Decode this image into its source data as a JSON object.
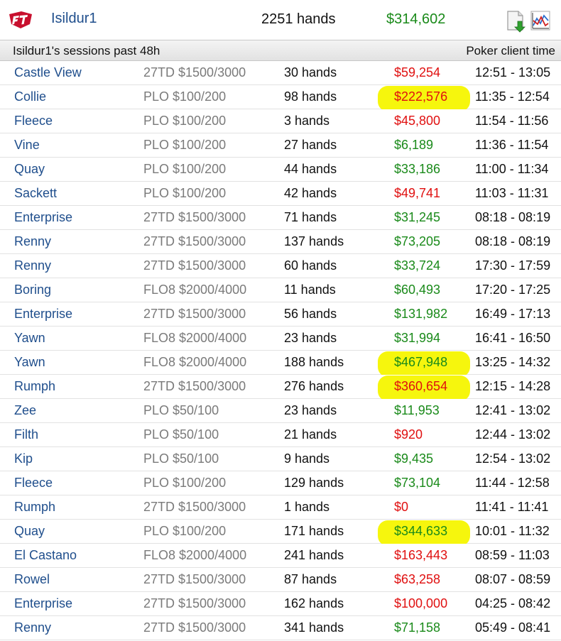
{
  "header": {
    "player_name": "Isildur1",
    "total_hands": "2251 hands",
    "total_profit": "$314,602",
    "icons": [
      "full-tilt-logo-icon",
      "export-icon",
      "graph-icon"
    ],
    "accent_color": "#1f4e8c"
  },
  "subheader": {
    "title": "Isildur1's sessions past 48h",
    "right_label": "Poker client time"
  },
  "colors": {
    "positive": "#1a8a1a",
    "negative": "#e01010",
    "highlight": "#f5f500"
  },
  "sessions": [
    {
      "table": "Castle View",
      "game": "27TD $1500/3000",
      "hands": "30 hands",
      "profit": "$59,254",
      "sign": "neg",
      "time": "12:51 - 13:05",
      "highlight": false
    },
    {
      "table": "Collie",
      "game": "PLO $100/200",
      "hands": "98 hands",
      "profit": "$222,576",
      "sign": "neg",
      "time": "11:35 - 12:54",
      "highlight": true
    },
    {
      "table": "Fleece",
      "game": "PLO $100/200",
      "hands": "3 hands",
      "profit": "$45,800",
      "sign": "neg",
      "time": "11:54 - 11:56",
      "highlight": false
    },
    {
      "table": "Vine",
      "game": "PLO $100/200",
      "hands": "27 hands",
      "profit": "$6,189",
      "sign": "pos",
      "time": "11:36 - 11:54",
      "highlight": false
    },
    {
      "table": "Quay",
      "game": "PLO $100/200",
      "hands": "44 hands",
      "profit": "$33,186",
      "sign": "pos",
      "time": "11:00 - 11:34",
      "highlight": false
    },
    {
      "table": "Sackett",
      "game": "PLO $100/200",
      "hands": "42 hands",
      "profit": "$49,741",
      "sign": "neg",
      "time": "11:03 - 11:31",
      "highlight": false
    },
    {
      "table": "Enterprise",
      "game": "27TD $1500/3000",
      "hands": "71 hands",
      "profit": "$31,245",
      "sign": "pos",
      "time": "08:18 - 08:19",
      "highlight": false
    },
    {
      "table": "Renny",
      "game": "27TD $1500/3000",
      "hands": "137 hands",
      "profit": "$73,205",
      "sign": "pos",
      "time": "08:18 - 08:19",
      "highlight": false
    },
    {
      "table": "Renny",
      "game": "27TD $1500/3000",
      "hands": "60 hands",
      "profit": "$33,724",
      "sign": "pos",
      "time": "17:30 - 17:59",
      "highlight": false
    },
    {
      "table": "Boring",
      "game": "FLO8 $2000/4000",
      "hands": "11 hands",
      "profit": "$60,493",
      "sign": "pos",
      "time": "17:20 - 17:25",
      "highlight": false
    },
    {
      "table": "Enterprise",
      "game": "27TD $1500/3000",
      "hands": "56 hands",
      "profit": "$131,982",
      "sign": "pos",
      "time": "16:49 - 17:13",
      "highlight": false
    },
    {
      "table": "Yawn",
      "game": "FLO8 $2000/4000",
      "hands": "23 hands",
      "profit": "$31,994",
      "sign": "pos",
      "time": "16:41 - 16:50",
      "highlight": false
    },
    {
      "table": "Yawn",
      "game": "FLO8 $2000/4000",
      "hands": "188 hands",
      "profit": "$467,948",
      "sign": "pos",
      "time": "13:25 - 14:32",
      "highlight": true
    },
    {
      "table": "Rumph",
      "game": "27TD $1500/3000",
      "hands": "276 hands",
      "profit": "$360,654",
      "sign": "neg",
      "time": "12:15 - 14:28",
      "highlight": true
    },
    {
      "table": "Zee",
      "game": "PLO $50/100",
      "hands": "23 hands",
      "profit": "$11,953",
      "sign": "pos",
      "time": "12:41 - 13:02",
      "highlight": false
    },
    {
      "table": "Filth",
      "game": "PLO $50/100",
      "hands": "21 hands",
      "profit": "$920",
      "sign": "neg",
      "time": "12:44 - 13:02",
      "highlight": false
    },
    {
      "table": "Kip",
      "game": "PLO $50/100",
      "hands": "9 hands",
      "profit": "$9,435",
      "sign": "pos",
      "time": "12:54 - 13:02",
      "highlight": false
    },
    {
      "table": "Fleece",
      "game": "PLO $100/200",
      "hands": "129 hands",
      "profit": "$73,104",
      "sign": "pos",
      "time": "11:44 - 12:58",
      "highlight": false
    },
    {
      "table": "Rumph",
      "game": "27TD $1500/3000",
      "hands": "1 hands",
      "profit": "$0",
      "sign": "neg",
      "time": "11:41 - 11:41",
      "highlight": false
    },
    {
      "table": "Quay",
      "game": "PLO $100/200",
      "hands": "171 hands",
      "profit": "$344,633",
      "sign": "pos",
      "time": "10:01 - 11:32",
      "highlight": true
    },
    {
      "table": "El Castano",
      "game": "FLO8 $2000/4000",
      "hands": "241 hands",
      "profit": "$163,443",
      "sign": "neg",
      "time": "08:59 - 11:03",
      "highlight": false
    },
    {
      "table": "Rowel",
      "game": "27TD $1500/3000",
      "hands": "87 hands",
      "profit": "$63,258",
      "sign": "neg",
      "time": "08:07 - 08:59",
      "highlight": false
    },
    {
      "table": "Enterprise",
      "game": "27TD $1500/3000",
      "hands": "162 hands",
      "profit": "$100,000",
      "sign": "neg",
      "time": "04:25 - 08:42",
      "highlight": false
    },
    {
      "table": "Renny",
      "game": "27TD $1500/3000",
      "hands": "341 hands",
      "profit": "$71,158",
      "sign": "pos",
      "time": "05:49 - 08:41",
      "highlight": false
    }
  ]
}
